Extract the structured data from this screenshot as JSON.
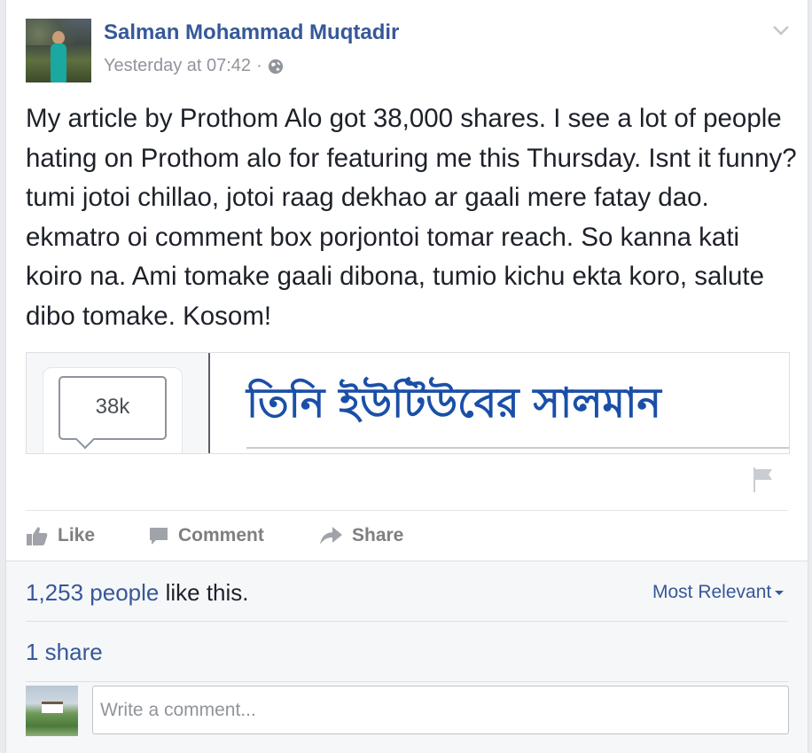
{
  "post": {
    "author_name": "Salman Mohammad Muqtadir",
    "timestamp": "Yesterday at 07:42",
    "timestamp_separator": "·",
    "privacy_icon": "globe-icon",
    "options_icon": "chevron-down-icon",
    "body_text": "My article by Prothom Alo got 38,000 shares. I see a lot of people hating on Prothom alo for featuring me this Thursday. Isnt it funny? tumi jotoi chillao, jotoi raag dekhao ar gaali mere fatay dao. ekmatro oi comment box porjontoi tomar reach. So kanna kati koiro na. Ami tomake gaali dibona, tumio kichu ekta koro, salute dibo tomake. Kosom!"
  },
  "link_preview": {
    "share_count": "38k",
    "headline": "তিনি ইউটিউবের সালমান",
    "report_icon": "flag-icon"
  },
  "actions": {
    "like_label": "Like",
    "comment_label": "Comment",
    "share_label": "Share"
  },
  "reactions": {
    "likes_count": "1,253 people",
    "likes_suffix": " like this.",
    "sort_label": "Most Relevant",
    "shares_text": "1 share"
  },
  "comment_box": {
    "placeholder": "Write a comment..."
  },
  "colors": {
    "link_blue": "#365899",
    "headline_blue": "#1a4fa8",
    "text": "#1d2129",
    "muted": "#90949c",
    "action_gray": "#7f7f7f"
  }
}
